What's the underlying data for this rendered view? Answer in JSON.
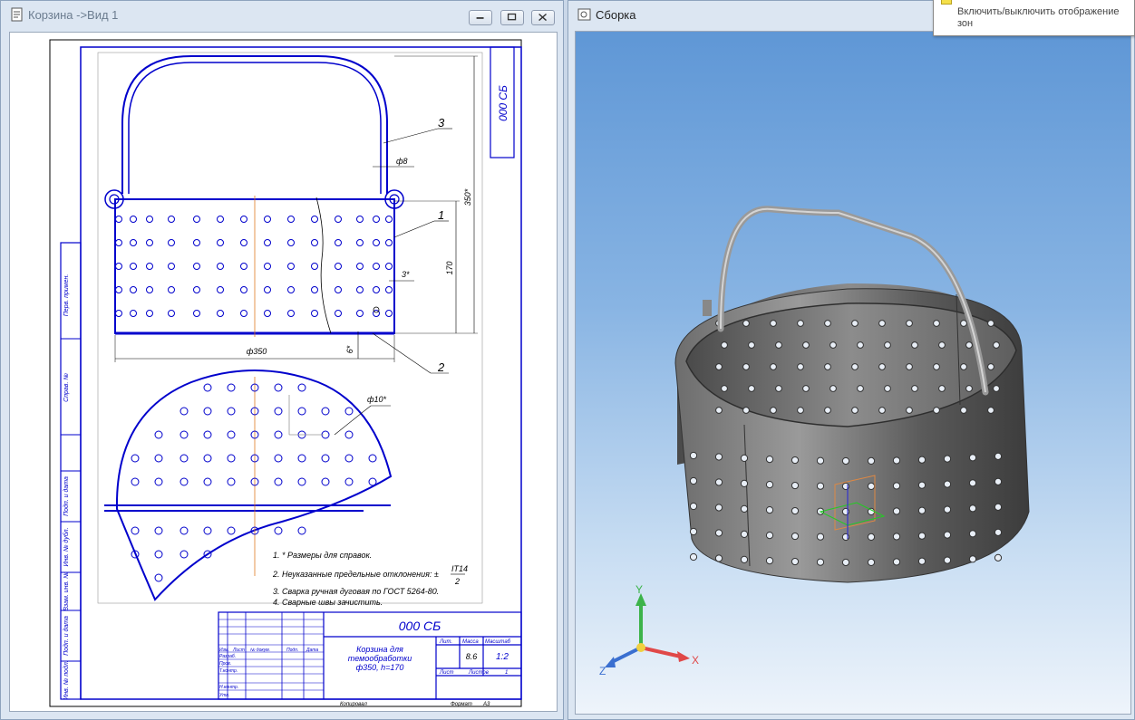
{
  "left_window": {
    "title": "Корзина ->Вид 1"
  },
  "right_window": {
    "title": "Сборка"
  },
  "tooltip": {
    "text": "Включить/выключить отображение зон"
  },
  "drawing": {
    "designation": "000 СБ",
    "title_lines": [
      "Корзина для",
      "темообработки",
      "ф350, h=170"
    ],
    "callouts": [
      "1",
      "2",
      "3"
    ],
    "dims": {
      "d8": "ф8",
      "h350": "350*",
      "h170": "170",
      "t3": "3*",
      "d350": "ф350",
      "t6": "6*",
      "d10": "ф10*"
    },
    "notes": [
      "1. * Размеры для справок.",
      "2. Неуказанные предельные отклонения: ±",
      "3. Сварка ручная дуговая по ГОСТ 5264-80.",
      "4. Сварные швы зачистить."
    ],
    "tolerance_fraction": {
      "num": "IT14",
      "den": "2"
    },
    "stamp": {
      "lit": "Лит.",
      "mass_label": "Масса",
      "scale_label": "Масштаб",
      "mass": "8.6",
      "scale": "1:2",
      "sheet": "Лист",
      "sheets": "Листов",
      "sheets_value": "1",
      "rows": [
        "Изм.",
        "Лист",
        "№ докум.",
        "Подп.",
        "Дата"
      ],
      "roles": [
        "Разраб.",
        "Пров.",
        "Т.контр.",
        "",
        "Н.контр.",
        "Утв."
      ],
      "copied": "Копировал",
      "format": "Формат",
      "format_value": "A3"
    },
    "side_labels": [
      "Перв. примен.",
      "Справ. №",
      "Подп. и дата",
      "Инв. № дубл.",
      "Взам. инв. №",
      "Подп. и дата",
      "Инв. № подл."
    ]
  },
  "axes": {
    "x": "X",
    "y": "Y",
    "z": "Z"
  }
}
